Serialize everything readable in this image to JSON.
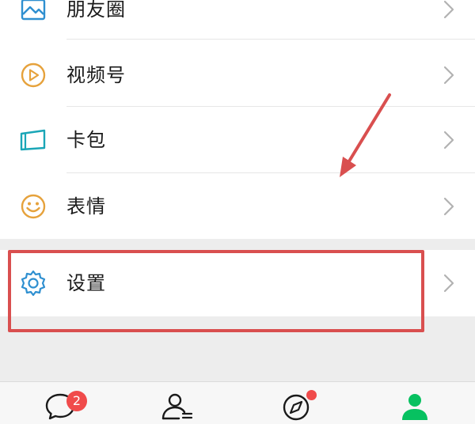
{
  "menu": {
    "items": [
      {
        "label": "朋友圈",
        "icon": "moments-icon"
      },
      {
        "label": "视频号",
        "icon": "channels-icon"
      },
      {
        "label": "卡包",
        "icon": "card-wallet-icon"
      },
      {
        "label": "表情",
        "icon": "sticker-icon"
      }
    ],
    "settings": {
      "label": "设置",
      "icon": "gear-icon"
    }
  },
  "tabbar": {
    "chats_badge": "2",
    "tabs": [
      {
        "name": "chats",
        "icon": "chat-bubble-icon"
      },
      {
        "name": "contacts",
        "icon": "contacts-icon"
      },
      {
        "name": "discover",
        "icon": "compass-icon"
      },
      {
        "name": "me",
        "icon": "profile-icon",
        "active": true
      }
    ]
  },
  "colors": {
    "accent_green": "#07c160",
    "annotation_red": "#d94f4f",
    "badge_red": "#f04b4b",
    "icon_blue": "#2e8fd0",
    "icon_orange": "#e6a23c"
  }
}
